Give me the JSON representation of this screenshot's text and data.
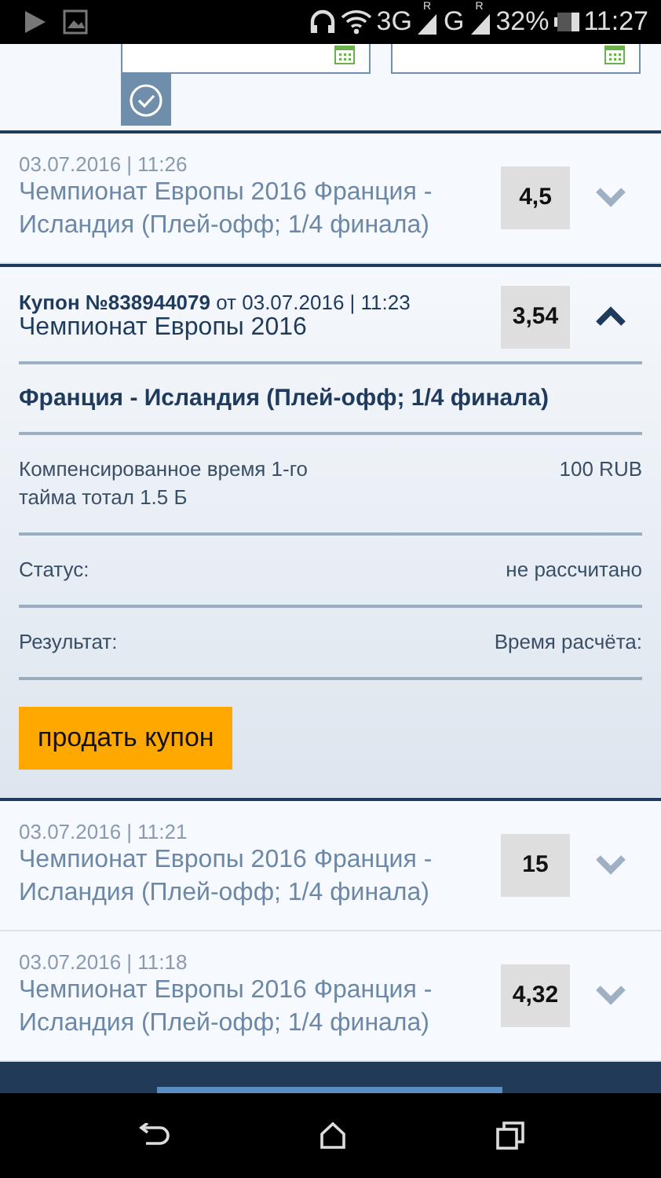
{
  "status_bar": {
    "network_1": "3G",
    "roaming_1": "R",
    "network_2": "G",
    "roaming_2": "R",
    "battery": "32%",
    "time": "11:27"
  },
  "coupons": [
    {
      "expanded": false,
      "header": "03.07.2016 | 11:26",
      "title": "Чемпионат Европы 2016 Франция - Исландия (Плей-офф; 1/4 финала)",
      "odds": "4,5"
    },
    {
      "expanded": true,
      "header": "**Купон №838944079** от 03.07.2016 | 11:23",
      "title": "Чемпионат Европы 2016",
      "odds": "3,54",
      "match": "Франция - Исландия (Плей-офф; 1/4 финала)",
      "bet": "Компенсированное время 1-го тайма тотал 1.5 Б",
      "stake": "100 RUB",
      "details": [
        {
          "label": "Статус:",
          "value": "не рассчитано"
        },
        {
          "label": "Результат:",
          "value": "Время расчёта:"
        }
      ],
      "action": "продать купон"
    },
    {
      "expanded": false,
      "header": "03.07.2016 | 11:21",
      "title": "Чемпионат Европы 2016 Франция - Исландия (Плей-офф; 1/4 финала)",
      "odds": "15"
    },
    {
      "expanded": false,
      "header": "03.07.2016 | 11:18",
      "title": "Чемпионат Европы 2016 Франция - Исландия (Плей-офф; 1/4 финала)",
      "odds": "4,32"
    }
  ]
}
